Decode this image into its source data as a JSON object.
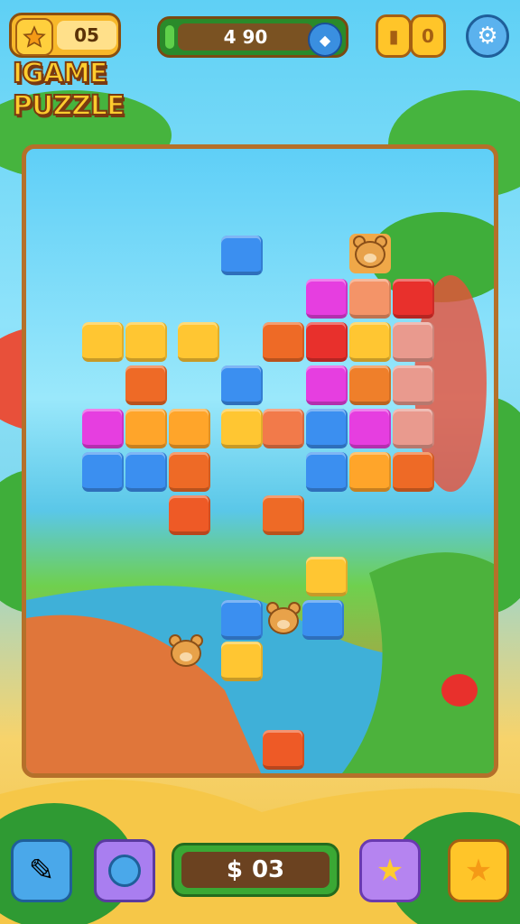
{
  "hud": {
    "stars": "05",
    "score": "4 90",
    "coin_counter": "0"
  },
  "logo": {
    "line1": "IGAME",
    "line2": "PUZZLE"
  },
  "bottom_bar": {
    "money": "03",
    "money_symbol": "$"
  },
  "board": {
    "tiles": [
      {
        "row": "r1",
        "color": "#3b8ff0"
      },
      {
        "color": "#e63ee0"
      },
      {
        "color": "#f49468"
      },
      {
        "color": "#e8302c"
      },
      {
        "color": "#ffc632"
      },
      {
        "color": "#ffc632"
      },
      {
        "color": "#ffc632"
      },
      {
        "color": "#ee6a26"
      },
      {
        "color": "#e8302c"
      },
      {
        "color": "#ffc632"
      },
      {
        "color": "#e99a8e"
      },
      {
        "color": "#ee6a26"
      },
      {
        "color": "#3b8ff0"
      },
      {
        "color": "#e63ee0"
      },
      {
        "color": "#ef7f2a"
      },
      {
        "color": "#e99a8e"
      },
      {
        "color": "#e63ee0"
      },
      {
        "color": "#ffa52a"
      },
      {
        "color": "#ffa52a"
      },
      {
        "color": "#ffc632"
      },
      {
        "color": "#f27a4a"
      },
      {
        "color": "#3b8ff0"
      },
      {
        "color": "#e63ee0"
      },
      {
        "color": "#e99a8e"
      },
      {
        "color": "#3b8ff0"
      },
      {
        "color": "#3b8ff0"
      },
      {
        "color": "#ee6a26"
      },
      {
        "color": "#3b8ff0"
      },
      {
        "color": "#ffa52a"
      },
      {
        "color": "#ee6a26"
      }
    ]
  },
  "icons": [
    "star-icon",
    "gem-icon",
    "coin-icon",
    "gear-icon",
    "pencil-icon",
    "bubble-icon",
    "star-icon"
  ]
}
